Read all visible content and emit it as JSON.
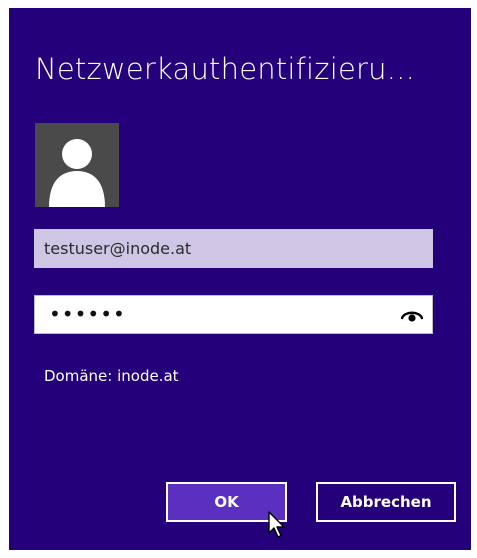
{
  "dialog": {
    "title": "Netzwerkauthentifizieru...",
    "avatar_icon": "user-silhouette-icon",
    "username_value": "testuser@inode.at",
    "password_masked": "••••••",
    "reveal_icon": "eye-icon",
    "domain_text": "Domäne: inode.at",
    "ok_label": "OK",
    "cancel_label": "Abbrechen"
  },
  "colors": {
    "background": "#24007a",
    "ok_button": "#5b2fbf",
    "username_field": "#cfc6e6",
    "avatar": "#4a4a4a"
  }
}
